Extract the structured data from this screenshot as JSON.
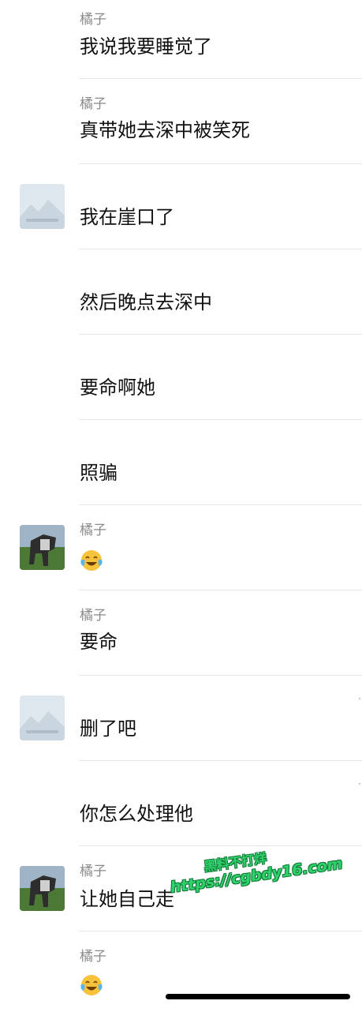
{
  "messages": [
    {
      "sender": "橘子",
      "text": "我说我要睡觉了"
    },
    {
      "sender": "橘子",
      "text": "真带她去深中被笑死"
    },
    {
      "avatar_caption": "暂时无法显示",
      "text": "我在崖口了"
    },
    {
      "text": "然后晚点去深中"
    },
    {
      "text": "要命啊她"
    },
    {
      "text": "照骗"
    },
    {
      "sender": "橘子",
      "emoji": "face-with-tears-of-joy"
    },
    {
      "sender": "橘子",
      "text": "要命"
    },
    {
      "avatar_caption": "暂时无法显示",
      "text": "删了吧"
    },
    {
      "text": "你怎么处理他"
    },
    {
      "sender": "橘子",
      "text": "让她自己走"
    },
    {
      "sender": "橘子",
      "emoji": "face-with-tears-of-joy"
    }
  ],
  "watermark": {
    "line1": "黑料不打烊",
    "line2": "https://cgbdy16.com"
  },
  "colors": {
    "sender_name": "#8a8a8a",
    "message_text": "#111111",
    "divider": "#e6e6e6",
    "watermark": "#2fd16a"
  }
}
